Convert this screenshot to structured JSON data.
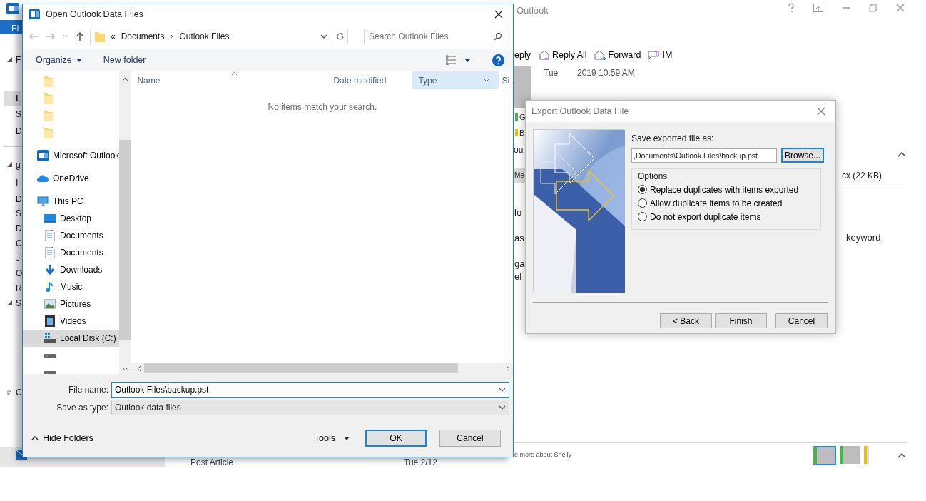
{
  "outlook": {
    "title": "Outlook",
    "file_tab": "FI",
    "nav_fragments": [
      {
        "label": "F",
        "kind": "header"
      },
      {
        "label": "I",
        "kind": "selected"
      },
      {
        "label": "S",
        "kind": "item"
      },
      {
        "label": "D",
        "kind": "item"
      },
      {
        "label": "g",
        "kind": "header"
      },
      {
        "label": "I",
        "kind": "item"
      },
      {
        "label": "D",
        "kind": "item"
      },
      {
        "label": "S",
        "kind": "item"
      },
      {
        "label": "D",
        "kind": "item"
      },
      {
        "label": "C",
        "kind": "item"
      },
      {
        "label": "J",
        "kind": "item"
      },
      {
        "label": "O",
        "kind": "item"
      },
      {
        "label": "R",
        "kind": "item"
      },
      {
        "label": "S",
        "kind": "header"
      },
      {
        "label": "C",
        "kind": "collapsed"
      }
    ],
    "actions": [
      {
        "label": "eply",
        "kind": "reply"
      },
      {
        "label": "Reply All",
        "kind": "reply-all"
      },
      {
        "label": "Forward",
        "kind": "forward"
      },
      {
        "label": "IM",
        "kind": "im"
      }
    ],
    "header": {
      "date": "Tue",
      "time": "2019 10:59 AM"
    },
    "categories": [
      {
        "label": "G",
        "color": "#4caf50"
      },
      {
        "label": "B",
        "color": "#f0c000"
      }
    ],
    "you_fragment": "ou",
    "attachment_tab": "Me",
    "attachment": "cx (22 KB)",
    "body_fragments": [
      "lo",
      "as",
      "ga",
      "el"
    ],
    "body_end": "keyword.",
    "people_link": "e more about Shelly",
    "list_item": {
      "subject": "Post Article",
      "date": "Tue 2/12"
    }
  },
  "open_dialog": {
    "title": "Open Outlook Data Files",
    "path": [
      "«",
      "Documents",
      "Outlook Files"
    ],
    "search": {
      "placeholder": "Search Outlook Files"
    },
    "toolbar": {
      "organize": "Organize",
      "new_folder": "New folder"
    },
    "columns": [
      {
        "label": "Name",
        "selected": false
      },
      {
        "label": "Date modified",
        "selected": false
      },
      {
        "label": "Type",
        "selected": true
      },
      {
        "label": "Si",
        "selected": false
      }
    ],
    "empty_message": "No items match your search.",
    "quick_access": [
      {
        "kind": "folder"
      },
      {
        "kind": "folder"
      },
      {
        "kind": "folder"
      },
      {
        "kind": "folder"
      }
    ],
    "nav": [
      {
        "label": "Microsoft Outlook",
        "kind": "outlook",
        "selected": false
      },
      {
        "label": "OneDrive",
        "kind": "cloud",
        "selected": false
      },
      {
        "label": "This PC",
        "kind": "pc",
        "selected": false,
        "children": [
          {
            "label": "Desktop",
            "kind": "desktop",
            "selected": false
          },
          {
            "label": "Documents",
            "kind": "document",
            "selected": false
          },
          {
            "label": "Documents",
            "kind": "document",
            "selected": false
          },
          {
            "label": "Downloads",
            "kind": "download",
            "selected": false
          },
          {
            "label": "Music",
            "kind": "music",
            "selected": false
          },
          {
            "label": "Pictures",
            "kind": "pictures",
            "selected": false
          },
          {
            "label": "Videos",
            "kind": "videos",
            "selected": false
          },
          {
            "label": "Local Disk (C:)",
            "kind": "localdisk",
            "selected": true
          },
          {
            "kind": "drive",
            "selected": false
          },
          {
            "kind": "drive",
            "selected": false
          }
        ]
      }
    ],
    "file_name": {
      "label": "File name:",
      "value": "Outlook Files\\backup.pst"
    },
    "save_type": {
      "label": "Save as type:",
      "value": "Outlook data files"
    },
    "hide_folders": "Hide Folders",
    "tools": "Tools",
    "ok": "OK",
    "cancel": "Cancel"
  },
  "export_dialog": {
    "title": "Export Outlook Data File",
    "save_label": "Save exported file as:",
    "path": ",Documents\\Outlook Files\\backup.pst",
    "browse": "Browse...",
    "options_label": "Options",
    "options": [
      {
        "label": "Replace duplicates with items exported",
        "selected": true
      },
      {
        "label": "Allow duplicate items to be created",
        "selected": false
      },
      {
        "label": "Do not export duplicate items",
        "selected": false
      }
    ],
    "back": "< Back",
    "finish": "Finish",
    "cancel": "Cancel"
  }
}
